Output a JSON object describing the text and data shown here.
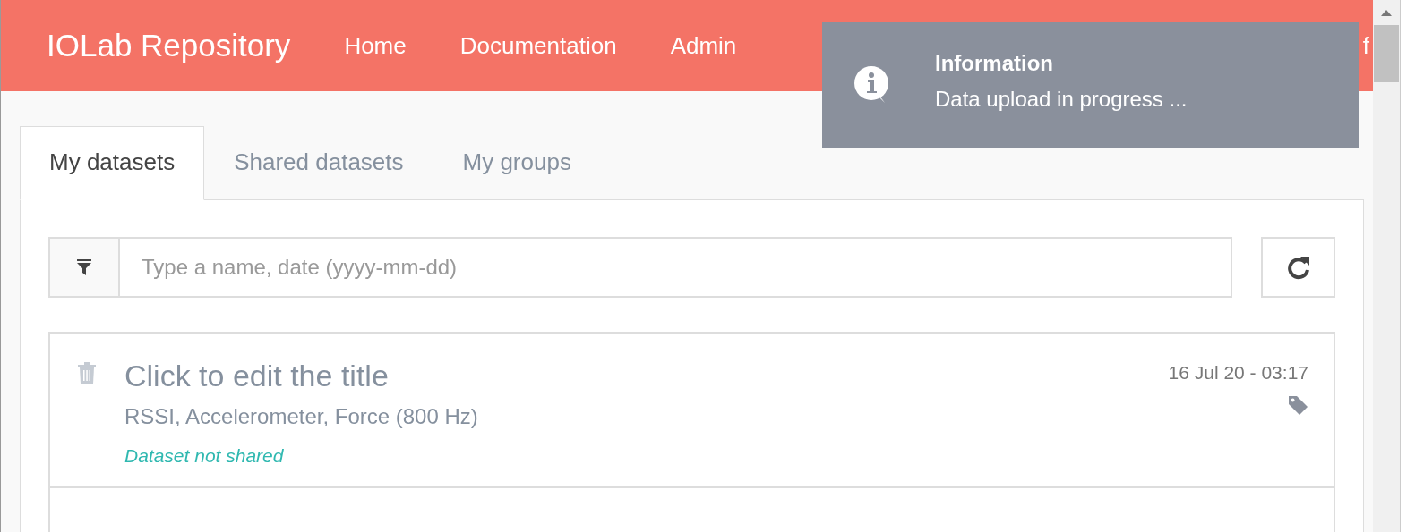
{
  "header": {
    "brand": "IOLab Repository",
    "nav": [
      {
        "label": "Home"
      },
      {
        "label": "Documentation"
      },
      {
        "label": "Admin"
      },
      {
        "label": "f"
      }
    ]
  },
  "toast": {
    "title": "Information",
    "message": "Data upload in progress ..."
  },
  "tabs": [
    {
      "label": "My datasets",
      "selected": true
    },
    {
      "label": "Shared datasets",
      "selected": false
    },
    {
      "label": "My groups",
      "selected": false
    }
  ],
  "search": {
    "placeholder": "Type a name, date (yyyy-mm-dd)"
  },
  "datasets": [
    {
      "title": "Click to edit the title",
      "date": "16 Jul 20 - 03:17",
      "sensors": "RSSI, Accelerometer, Force (800 Hz)",
      "status": "Dataset not shared",
      "tagged": true
    }
  ]
}
